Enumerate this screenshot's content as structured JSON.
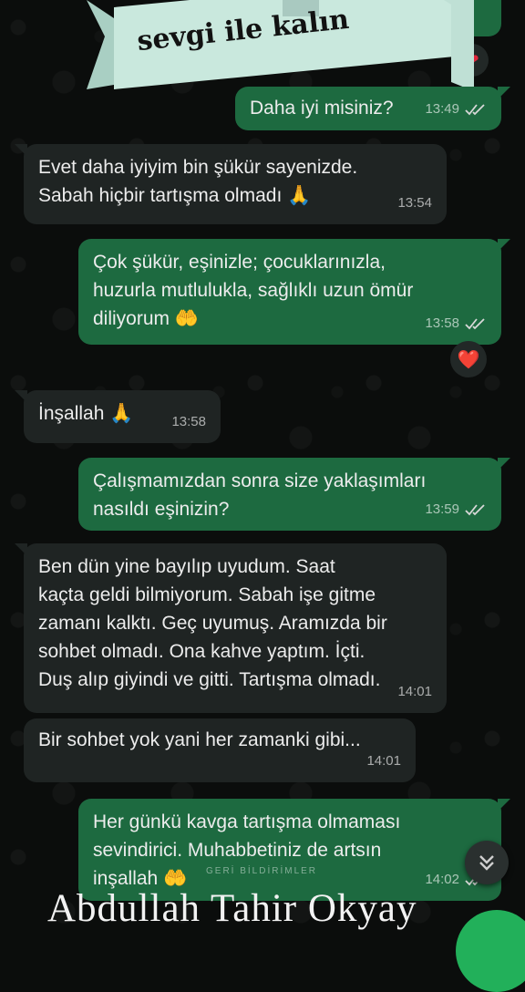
{
  "banner": {
    "text": "sevgi ile kalın"
  },
  "messages": [
    {
      "id": "m1",
      "direction": "outgoing",
      "text": "Daha iyi misiniz?",
      "time": "13:49",
      "read": true
    },
    {
      "id": "m2",
      "direction": "incoming",
      "text": "Evet daha iyiyim bin şükür sayenizde.\nSabah hiçbir tartışma olmadı 🙏",
      "time": "13:54"
    },
    {
      "id": "m3",
      "direction": "outgoing",
      "text": "Çok şükür, eşinizle; çocuklarınızla,\nhuzurla mutlulukla, sağlıklı uzun ömür\ndiliyorum 🤲",
      "time": "13:58",
      "read": true,
      "reaction": "❤️"
    },
    {
      "id": "m4",
      "direction": "incoming",
      "text": "İnşallah 🙏",
      "time": "13:58"
    },
    {
      "id": "m5",
      "direction": "outgoing",
      "text": "Çalışmamızdan sonra size yaklaşımları\nnasıldı eşinizin?",
      "time": "13:59",
      "read": true
    },
    {
      "id": "m6",
      "direction": "incoming",
      "text": "Ben dün yine bayılıp uyudum. Saat\nkaçta geldi bilmiyorum. Sabah işe gitme\nzamanı kalktı. Geç uyumuş. Aramızda bir\nsohbet olmadı. Ona kahve yaptım. İçti.\nDuş alıp giyindi ve gitti. Tartışma olmadı.",
      "time": "14:01"
    },
    {
      "id": "m7",
      "direction": "incoming",
      "text": "Bir sohbet yok yani her zamanki gibi...",
      "time": "14:01"
    },
    {
      "id": "m8",
      "direction": "outgoing",
      "text": "Her günkü kavga tartışma olmaması\nsevindirici. Muhabbetiniz de artsın\ninşallah 🤲",
      "time": "14:02",
      "read": true
    }
  ],
  "feedback_label": "GERİ BİLDİRİMLER",
  "watermark": "Abdullah Tahir Okyay",
  "colors": {
    "incoming": "#1f2423",
    "outgoing": "#1d6a40",
    "accent": "#22b05a",
    "ribbon": "#c9e8dd"
  },
  "icons": {
    "read": "double-check-icon",
    "scroll": "chevron-double-down-icon",
    "reaction": "heart-icon"
  }
}
